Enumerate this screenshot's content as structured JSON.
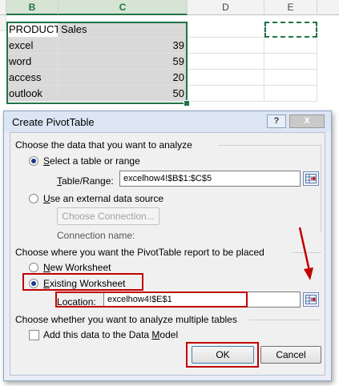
{
  "sheet": {
    "columns": [
      "B",
      "C",
      "D",
      "E"
    ],
    "rows": [
      {
        "b": "PRODUCT",
        "c": "Sales"
      },
      {
        "b": "excel",
        "c": "39"
      },
      {
        "b": "word",
        "c": "59"
      },
      {
        "b": "access",
        "c": "20"
      },
      {
        "b": "outlook",
        "c": "50"
      }
    ]
  },
  "dialog": {
    "title": "Create PivotTable",
    "help_label": "?",
    "close_label": "X",
    "section1": "Choose the data that you want to analyze",
    "select_table_pre": "",
    "select_table_hot": "S",
    "select_table_post": "elect a table or range",
    "table_range_pre": "",
    "table_range_hot": "T",
    "table_range_post": "able/Range:",
    "table_range_value": "excelhow4!$B$1:$C$5",
    "external_hot": "U",
    "external_post": "se an external data source",
    "choose_connection": "Choose Connection...",
    "connection_name": "Connection name:",
    "section2": "Choose where you want the PivotTable report to be placed",
    "new_ws_hot": "N",
    "new_ws_post": "ew Worksheet",
    "existing_hot": "E",
    "existing_post": "xisting Worksheet",
    "location_hot": "L",
    "location_post": "ocation:",
    "location_value": "excelhow4!$E$1",
    "section3": "Choose whether you want to analyze multiple tables",
    "data_model_pre": "Add this data to the Data ",
    "data_model_hot": "M",
    "data_model_post": "odel",
    "ok_label": "OK",
    "cancel_label": "Cancel"
  },
  "colors": {
    "excel_green": "#217346",
    "annotation_red": "#c00000",
    "dialog_frame": "#8ea4c4"
  },
  "icons": [
    "help-icon",
    "close-icon",
    "range-selector-icon",
    "red-arrow-annotation"
  ]
}
